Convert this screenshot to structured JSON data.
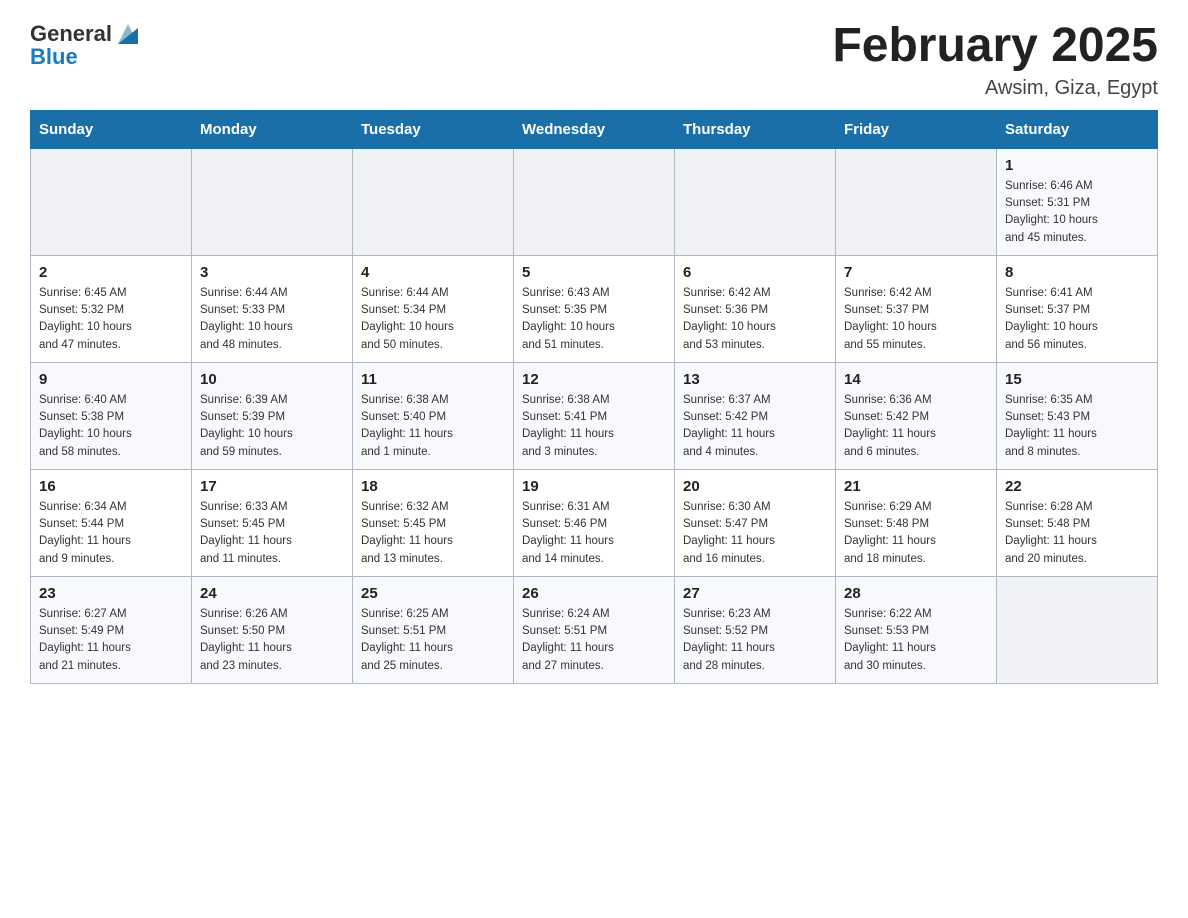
{
  "header": {
    "logo_general": "General",
    "logo_blue": "Blue",
    "month_title": "February 2025",
    "subtitle": "Awsim, Giza, Egypt"
  },
  "days_of_week": [
    "Sunday",
    "Monday",
    "Tuesday",
    "Wednesday",
    "Thursday",
    "Friday",
    "Saturday"
  ],
  "weeks": [
    [
      {
        "day": "",
        "info": ""
      },
      {
        "day": "",
        "info": ""
      },
      {
        "day": "",
        "info": ""
      },
      {
        "day": "",
        "info": ""
      },
      {
        "day": "",
        "info": ""
      },
      {
        "day": "",
        "info": ""
      },
      {
        "day": "1",
        "info": "Sunrise: 6:46 AM\nSunset: 5:31 PM\nDaylight: 10 hours\nand 45 minutes."
      }
    ],
    [
      {
        "day": "2",
        "info": "Sunrise: 6:45 AM\nSunset: 5:32 PM\nDaylight: 10 hours\nand 47 minutes."
      },
      {
        "day": "3",
        "info": "Sunrise: 6:44 AM\nSunset: 5:33 PM\nDaylight: 10 hours\nand 48 minutes."
      },
      {
        "day": "4",
        "info": "Sunrise: 6:44 AM\nSunset: 5:34 PM\nDaylight: 10 hours\nand 50 minutes."
      },
      {
        "day": "5",
        "info": "Sunrise: 6:43 AM\nSunset: 5:35 PM\nDaylight: 10 hours\nand 51 minutes."
      },
      {
        "day": "6",
        "info": "Sunrise: 6:42 AM\nSunset: 5:36 PM\nDaylight: 10 hours\nand 53 minutes."
      },
      {
        "day": "7",
        "info": "Sunrise: 6:42 AM\nSunset: 5:37 PM\nDaylight: 10 hours\nand 55 minutes."
      },
      {
        "day": "8",
        "info": "Sunrise: 6:41 AM\nSunset: 5:37 PM\nDaylight: 10 hours\nand 56 minutes."
      }
    ],
    [
      {
        "day": "9",
        "info": "Sunrise: 6:40 AM\nSunset: 5:38 PM\nDaylight: 10 hours\nand 58 minutes."
      },
      {
        "day": "10",
        "info": "Sunrise: 6:39 AM\nSunset: 5:39 PM\nDaylight: 10 hours\nand 59 minutes."
      },
      {
        "day": "11",
        "info": "Sunrise: 6:38 AM\nSunset: 5:40 PM\nDaylight: 11 hours\nand 1 minute."
      },
      {
        "day": "12",
        "info": "Sunrise: 6:38 AM\nSunset: 5:41 PM\nDaylight: 11 hours\nand 3 minutes."
      },
      {
        "day": "13",
        "info": "Sunrise: 6:37 AM\nSunset: 5:42 PM\nDaylight: 11 hours\nand 4 minutes."
      },
      {
        "day": "14",
        "info": "Sunrise: 6:36 AM\nSunset: 5:42 PM\nDaylight: 11 hours\nand 6 minutes."
      },
      {
        "day": "15",
        "info": "Sunrise: 6:35 AM\nSunset: 5:43 PM\nDaylight: 11 hours\nand 8 minutes."
      }
    ],
    [
      {
        "day": "16",
        "info": "Sunrise: 6:34 AM\nSunset: 5:44 PM\nDaylight: 11 hours\nand 9 minutes."
      },
      {
        "day": "17",
        "info": "Sunrise: 6:33 AM\nSunset: 5:45 PM\nDaylight: 11 hours\nand 11 minutes."
      },
      {
        "day": "18",
        "info": "Sunrise: 6:32 AM\nSunset: 5:45 PM\nDaylight: 11 hours\nand 13 minutes."
      },
      {
        "day": "19",
        "info": "Sunrise: 6:31 AM\nSunset: 5:46 PM\nDaylight: 11 hours\nand 14 minutes."
      },
      {
        "day": "20",
        "info": "Sunrise: 6:30 AM\nSunset: 5:47 PM\nDaylight: 11 hours\nand 16 minutes."
      },
      {
        "day": "21",
        "info": "Sunrise: 6:29 AM\nSunset: 5:48 PM\nDaylight: 11 hours\nand 18 minutes."
      },
      {
        "day": "22",
        "info": "Sunrise: 6:28 AM\nSunset: 5:48 PM\nDaylight: 11 hours\nand 20 minutes."
      }
    ],
    [
      {
        "day": "23",
        "info": "Sunrise: 6:27 AM\nSunset: 5:49 PM\nDaylight: 11 hours\nand 21 minutes."
      },
      {
        "day": "24",
        "info": "Sunrise: 6:26 AM\nSunset: 5:50 PM\nDaylight: 11 hours\nand 23 minutes."
      },
      {
        "day": "25",
        "info": "Sunrise: 6:25 AM\nSunset: 5:51 PM\nDaylight: 11 hours\nand 25 minutes."
      },
      {
        "day": "26",
        "info": "Sunrise: 6:24 AM\nSunset: 5:51 PM\nDaylight: 11 hours\nand 27 minutes."
      },
      {
        "day": "27",
        "info": "Sunrise: 6:23 AM\nSunset: 5:52 PM\nDaylight: 11 hours\nand 28 minutes."
      },
      {
        "day": "28",
        "info": "Sunrise: 6:22 AM\nSunset: 5:53 PM\nDaylight: 11 hours\nand 30 minutes."
      },
      {
        "day": "",
        "info": ""
      }
    ]
  ]
}
